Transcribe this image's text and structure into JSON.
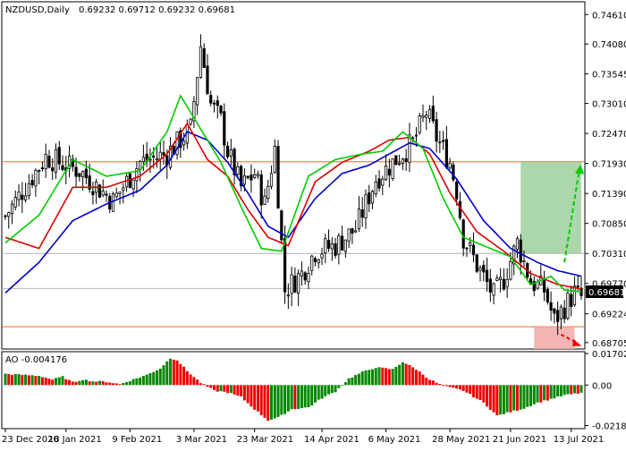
{
  "header": {
    "symbol_label": "NZDUSD,Daily",
    "ohlc_values": "0.69232 0.69712 0.69232 0.69681"
  },
  "price_tag": "0.69681",
  "colors": {
    "bull_body": "#ffffff",
    "bear_body": "#000000",
    "fast_ma": "#00cc00",
    "mid_ma": "#dd0000",
    "slow_ma": "#0000cc",
    "resistance_line": "#e07020",
    "support_line": "#e07020",
    "target_up_zone": "#8fc98f",
    "target_down_zone": "#f3a8a8",
    "arrow_up": "#00cc00",
    "arrow_down": "#ee0000",
    "ao_up": "#008800",
    "ao_down": "#ee0000"
  },
  "chart_data": [
    {
      "type": "candlestick",
      "title": "NZDUSD,Daily",
      "y_ticks": [
        "0.74610",
        "0.74080",
        "0.73545",
        "0.73010",
        "0.72470",
        "0.71930",
        "0.71390",
        "0.70850",
        "0.70310",
        "0.69770",
        "0.69224",
        "0.68705"
      ],
      "ylim": [
        0.6859,
        0.7484
      ],
      "x_ticks": [
        "23 Dec 2020",
        "18 Jan 2021",
        "9 Feb 2021",
        "3 Mar 2021",
        "23 Mar 2021",
        "14 Apr 2021",
        "6 May 2021",
        "28 May 2021",
        "21 Jun 2021",
        "13 Jul 2021"
      ],
      "close_path": [
        [
          0,
          0.7098
        ],
        [
          12,
          0.7205
        ],
        [
          22,
          0.718
        ],
        [
          32,
          0.7125
        ],
        [
          40,
          0.7195
        ],
        [
          48,
          0.721
        ],
        [
          55,
          0.7255
        ],
        [
          58,
          0.7405
        ],
        [
          61,
          0.73
        ],
        [
          64,
          0.727
        ],
        [
          66,
          0.7215
        ],
        [
          70,
          0.715
        ],
        [
          74,
          0.7175
        ],
        [
          77,
          0.712
        ],
        [
          80,
          0.722
        ],
        [
          83,
          0.6965
        ],
        [
          88,
          0.6995
        ],
        [
          92,
          0.7035
        ],
        [
          98,
          0.7045
        ],
        [
          104,
          0.7075
        ],
        [
          110,
          0.7165
        ],
        [
          116,
          0.72
        ],
        [
          121,
          0.723
        ],
        [
          125,
          0.7285
        ],
        [
          128,
          0.724
        ],
        [
          132,
          0.7195
        ],
        [
          134,
          0.7145
        ],
        [
          136,
          0.706
        ],
        [
          138,
          0.7035
        ],
        [
          140,
          0.701
        ],
        [
          145,
          0.6955
        ],
        [
          148,
          0.6985
        ],
        [
          152,
          0.705
        ],
        [
          156,
          0.698
        ],
        [
          160,
          0.6965
        ],
        [
          163,
          0.691
        ],
        [
          166,
          0.6935
        ],
        [
          169,
          0.696
        ],
        [
          171,
          0.6952
        ]
      ],
      "series": [
        {
          "name": "",
          "color": "#0000cc",
          "points": [
            [
              0,
              0.696
            ],
            [
              10,
              0.7015
            ],
            [
              20,
              0.709
            ],
            [
              30,
              0.712
            ],
            [
              40,
              0.7145
            ],
            [
              48,
              0.719
            ],
            [
              54,
              0.725
            ],
            [
              60,
              0.7235
            ],
            [
              66,
              0.7195
            ],
            [
              72,
              0.714
            ],
            [
              78,
              0.708
            ],
            [
              84,
              0.706
            ],
            [
              92,
              0.713
            ],
            [
              100,
              0.7175
            ],
            [
              108,
              0.719
            ],
            [
              114,
              0.721
            ],
            [
              120,
              0.723
            ],
            [
              126,
              0.722
            ],
            [
              134,
              0.7165
            ],
            [
              142,
              0.709
            ],
            [
              150,
              0.704
            ],
            [
              158,
              0.7015
            ],
            [
              164,
              0.7
            ],
            [
              171,
              0.699
            ]
          ]
        },
        {
          "name": "",
          "color": "#dd0000",
          "points": [
            [
              0,
              0.706
            ],
            [
              10,
              0.704
            ],
            [
              20,
              0.715
            ],
            [
              30,
              0.715
            ],
            [
              40,
              0.717
            ],
            [
              48,
              0.721
            ],
            [
              54,
              0.7265
            ],
            [
              60,
              0.72
            ],
            [
              66,
              0.717
            ],
            [
              72,
              0.711
            ],
            [
              78,
              0.706
            ],
            [
              84,
              0.7045
            ],
            [
              92,
              0.716
            ],
            [
              100,
              0.7195
            ],
            [
              108,
              0.7215
            ],
            [
              114,
              0.7235
            ],
            [
              120,
              0.724
            ],
            [
              126,
              0.721
            ],
            [
              132,
              0.714
            ],
            [
              140,
              0.707
            ],
            [
              148,
              0.7035
            ],
            [
              156,
              0.6995
            ],
            [
              164,
              0.6975
            ],
            [
              171,
              0.6967
            ]
          ]
        },
        {
          "name": "",
          "color": "#00cc00",
          "points": [
            [
              0,
              0.705
            ],
            [
              10,
              0.71
            ],
            [
              20,
              0.72
            ],
            [
              30,
              0.717
            ],
            [
              40,
              0.718
            ],
            [
              48,
              0.725
            ],
            [
              52,
              0.7315
            ],
            [
              58,
              0.7255
            ],
            [
              64,
              0.7195
            ],
            [
              70,
              0.7115
            ],
            [
              76,
              0.704
            ],
            [
              82,
              0.7035
            ],
            [
              90,
              0.717
            ],
            [
              98,
              0.72
            ],
            [
              106,
              0.721
            ],
            [
              112,
              0.7215
            ],
            [
              118,
              0.725
            ],
            [
              124,
              0.722
            ],
            [
              130,
              0.713
            ],
            [
              136,
              0.706
            ],
            [
              142,
              0.7045
            ],
            [
              150,
              0.7025
            ],
            [
              156,
              0.6975
            ],
            [
              162,
              0.699
            ],
            [
              166,
              0.6965
            ],
            [
              171,
              0.6962
            ]
          ]
        }
      ],
      "levels": [
        0.7196,
        0.7031,
        0.6899
      ],
      "target_up_range": [
        0.7031,
        0.7196
      ],
      "target_down_range": [
        0.6859,
        0.6899
      ]
    },
    {
      "type": "bar",
      "title": "AO -0.004176",
      "y_ticks": [
        "0.017024",
        "0.00",
        "-0.021838"
      ],
      "ylim": [
        -0.0235,
        0.018
      ],
      "ao_path": [
        [
          0,
          0.006
        ],
        [
          5,
          0.0055
        ],
        [
          10,
          0.005
        ],
        [
          14,
          0.003
        ],
        [
          17,
          0.0045
        ],
        [
          20,
          0.0015
        ],
        [
          23,
          0.003
        ],
        [
          26,
          0.002
        ],
        [
          30,
          0.0018
        ],
        [
          34,
          0.0005
        ],
        [
          38,
          0.003
        ],
        [
          42,
          0.0055
        ],
        [
          46,
          0.009
        ],
        [
          49,
          0.0145
        ],
        [
          51,
          0.0135
        ],
        [
          54,
          0.0075
        ],
        [
          58,
          0.0012
        ],
        [
          62,
          -0.003
        ],
        [
          66,
          -0.004
        ],
        [
          70,
          -0.0065
        ],
        [
          74,
          -0.013
        ],
        [
          78,
          -0.019
        ],
        [
          81,
          -0.0175
        ],
        [
          85,
          -0.013
        ],
        [
          90,
          -0.012
        ],
        [
          94,
          -0.007
        ],
        [
          98,
          -0.0035
        ],
        [
          102,
          0.0035
        ],
        [
          106,
          0.007
        ],
        [
          110,
          0.0095
        ],
        [
          115,
          0.0085
        ],
        [
          118,
          0.0125
        ],
        [
          122,
          0.0085
        ],
        [
          126,
          0.003
        ],
        [
          130,
          -0.0005
        ],
        [
          136,
          -0.003
        ],
        [
          142,
          -0.0095
        ],
        [
          146,
          -0.0165
        ],
        [
          150,
          -0.0145
        ],
        [
          154,
          -0.0125
        ],
        [
          158,
          -0.0095
        ],
        [
          162,
          -0.0075
        ],
        [
          166,
          -0.0055
        ],
        [
          171,
          -0.0042
        ]
      ]
    }
  ]
}
